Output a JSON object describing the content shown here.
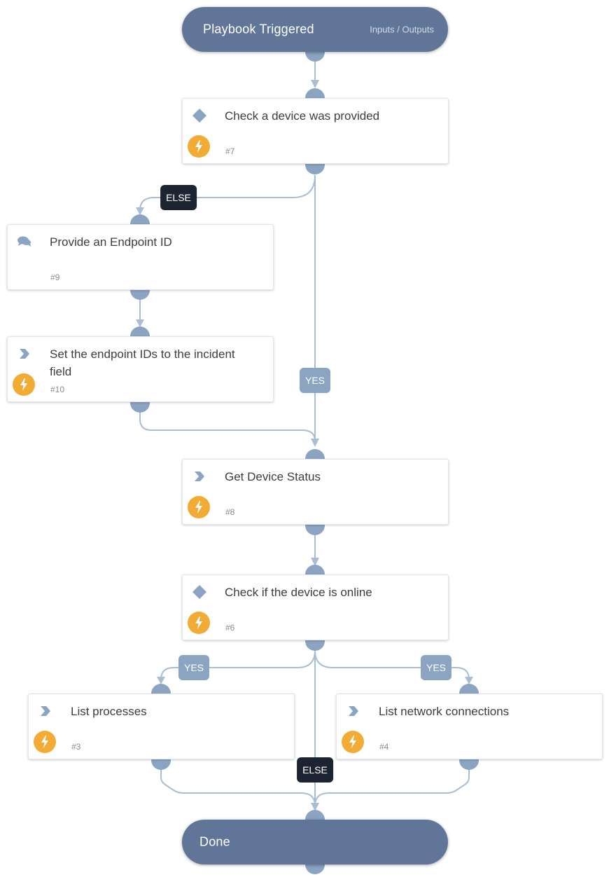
{
  "colors": {
    "pill": "#617598",
    "port": "#8aa4c2",
    "edge": "#a9bdd3",
    "else_label": "#1c2431",
    "yes_label": "#8aa4c2",
    "automation_badge": "#f2ab35"
  },
  "start": {
    "title": "Playbook Triggered",
    "link": "Inputs / Outputs"
  },
  "end": {
    "title": "Done"
  },
  "tasks": [
    {
      "id": "7",
      "number": "#7",
      "title": "Check a device was provided",
      "type_icon": "conditional-diamond-icon",
      "automated": true
    },
    {
      "id": "9",
      "number": "#9",
      "title": "Provide an Endpoint ID",
      "type_icon": "chat-bubbles-icon",
      "automated": false
    },
    {
      "id": "10",
      "number": "#10",
      "title": "Set the endpoint IDs to the incident field",
      "type_icon": "chevron-right-icon",
      "automated": true
    },
    {
      "id": "8",
      "number": "#8",
      "title": "Get Device Status",
      "type_icon": "chevron-right-icon",
      "automated": true
    },
    {
      "id": "6",
      "number": "#6",
      "title": "Check if the device is online",
      "type_icon": "conditional-diamond-icon",
      "automated": true
    },
    {
      "id": "3",
      "number": "#3",
      "title": "List processes",
      "type_icon": "chevron-right-icon",
      "automated": true
    },
    {
      "id": "4",
      "number": "#4",
      "title": "List network connections",
      "type_icon": "chevron-right-icon",
      "automated": true
    }
  ],
  "edge_labels": {
    "task7_else": "ELSE",
    "task7_yes": "YES",
    "task6_yes_left": "YES",
    "task6_yes_right": "YES",
    "task6_else": "ELSE"
  }
}
